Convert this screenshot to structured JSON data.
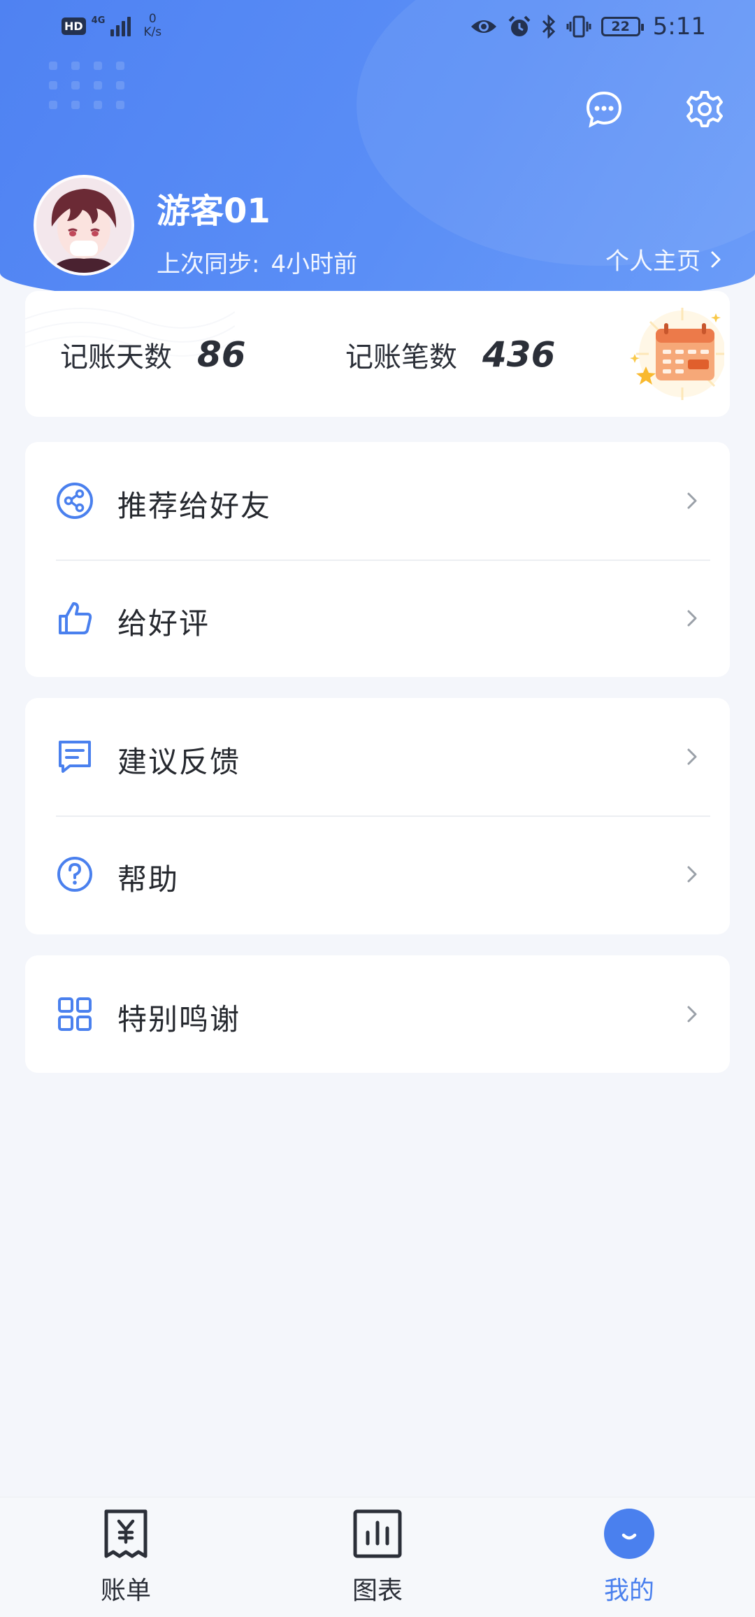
{
  "status_bar": {
    "hd": "HD",
    "network": "4G",
    "speed_value": "0",
    "speed_unit": "K/s",
    "battery": "22",
    "time": "5:11"
  },
  "profile": {
    "username": "游客01",
    "sync_label": "上次同步:",
    "sync_time": "4小时前",
    "homepage_label": "个人主页"
  },
  "stats": {
    "days_label": "记账天数",
    "days_value": "86",
    "records_label": "记账笔数",
    "records_value": "436"
  },
  "menu_groups": [
    {
      "items": [
        {
          "label": "推荐给好友",
          "icon": "share-icon"
        },
        {
          "label": "给好评",
          "icon": "thumbs-up-icon"
        }
      ]
    },
    {
      "items": [
        {
          "label": "建议反馈",
          "icon": "feedback-icon"
        },
        {
          "label": "帮助",
          "icon": "help-icon"
        }
      ]
    },
    {
      "items": [
        {
          "label": "特别鸣谢",
          "icon": "grid-icon"
        }
      ]
    }
  ],
  "bottom_nav": {
    "bills": "账单",
    "charts": "图表",
    "mine": "我的",
    "active": "mine"
  },
  "colors": {
    "header_blue": "#5388f4",
    "icon_blue": "#4a80ee",
    "page_bg": "#f4f6fb"
  }
}
